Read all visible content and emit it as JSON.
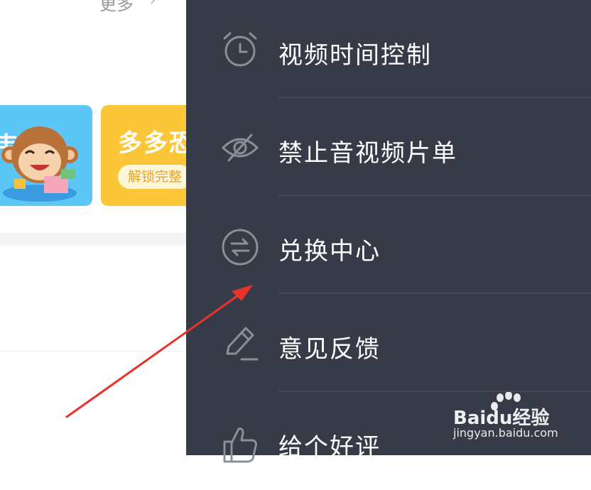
{
  "left_page": {
    "more_label": "更多",
    "more_chevron": "›",
    "card_blue_edge_text": "韦",
    "card_yellow_title": "多多恐",
    "card_yellow_button": "解锁完整"
  },
  "drawer": {
    "items": [
      {
        "label": "视频时间控制",
        "icon": "alarm-clock-icon"
      },
      {
        "label": "禁止音视频片单",
        "icon": "eye-off-icon"
      },
      {
        "label": "兑换中心",
        "icon": "exchange-icon"
      },
      {
        "label": "意见反馈",
        "icon": "pencil-icon"
      },
      {
        "label": "给个好评",
        "icon": "thumbs-up-icon"
      }
    ]
  },
  "watermark": {
    "brand": "Baidu经验",
    "url": "jingyan.baidu.com"
  },
  "colors": {
    "drawer_bg": "#363b47",
    "drawer_text": "#ffffff",
    "icon_stroke": "#8a8f9a",
    "arrow": "#e8332a",
    "card_blue": "#5cc6f6",
    "card_yellow": "#fbc638"
  }
}
